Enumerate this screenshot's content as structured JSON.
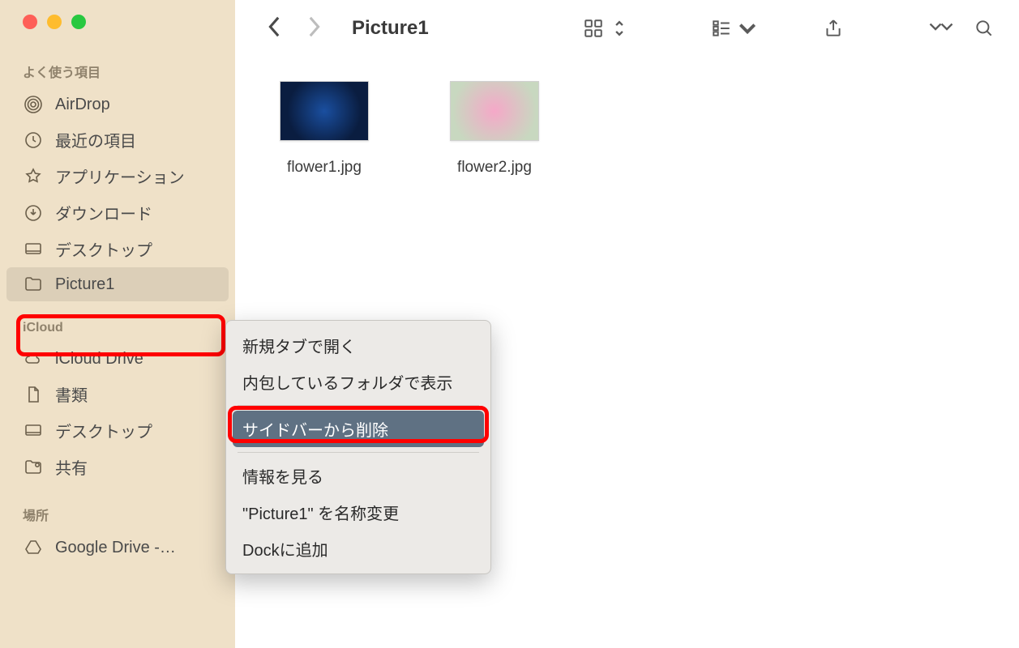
{
  "toolbar": {
    "title": "Picture1"
  },
  "sidebar": {
    "sections": {
      "favorites": {
        "heading": "よく使う項目",
        "items": [
          {
            "label": "AirDrop"
          },
          {
            "label": "最近の項目"
          },
          {
            "label": "アプリケーション"
          },
          {
            "label": "ダウンロード"
          },
          {
            "label": "デスクトップ"
          },
          {
            "label": "Picture1"
          }
        ]
      },
      "icloud": {
        "heading": "iCloud",
        "items": [
          {
            "label": "iCloud Drive"
          },
          {
            "label": "書類"
          },
          {
            "label": "デスクトップ"
          },
          {
            "label": "共有"
          }
        ]
      },
      "locations": {
        "heading": "場所",
        "items": [
          {
            "label": "Google Drive -…"
          }
        ]
      }
    }
  },
  "files": [
    {
      "name": "flower1.jpg"
    },
    {
      "name": "flower2.jpg"
    }
  ],
  "context_menu": {
    "items": [
      {
        "label": "新規タブで開く"
      },
      {
        "label": "内包しているフォルダで表示"
      },
      {
        "label": "サイドバーから削除",
        "selected": true
      },
      {
        "label": "情報を見る"
      },
      {
        "label": "\"Picture1\" を名称変更"
      },
      {
        "label": "Dockに追加"
      }
    ]
  }
}
